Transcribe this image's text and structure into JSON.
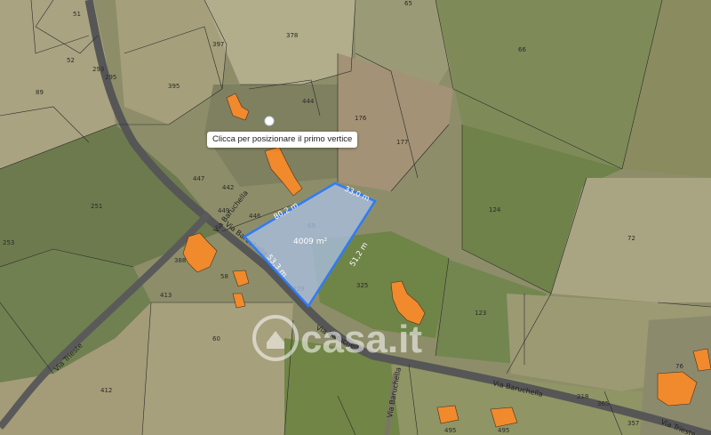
{
  "tooltip": "Clicca per posizionare il primo vertice",
  "watermark": "casa.it",
  "parcels": [
    "51",
    "65",
    "378",
    "397",
    "52",
    "66",
    "89",
    "395",
    "444",
    "176",
    "177",
    "251",
    "442",
    "449",
    "446",
    "447",
    "124",
    "253",
    "72",
    "69",
    "388",
    "413",
    "58",
    "329",
    "325",
    "123",
    "60",
    "412",
    "76",
    "218",
    "365",
    "495",
    "495",
    "357",
    "293",
    "295"
  ],
  "roads": [
    "Via Baruchella",
    "Via Baruchella",
    "Via Baruchella",
    "Via Baruchella",
    "Via Trieste",
    "Via Trieste"
  ],
  "measurement": {
    "area": "4009 m²",
    "sides": [
      "80,2 m",
      "33,0 m",
      "51,2 m",
      "53,3 m"
    ]
  },
  "colors": {
    "polygon_fill": "#a9bfe0",
    "polygon_stroke": "#2f7cf6",
    "building": "#f08a2c"
  }
}
